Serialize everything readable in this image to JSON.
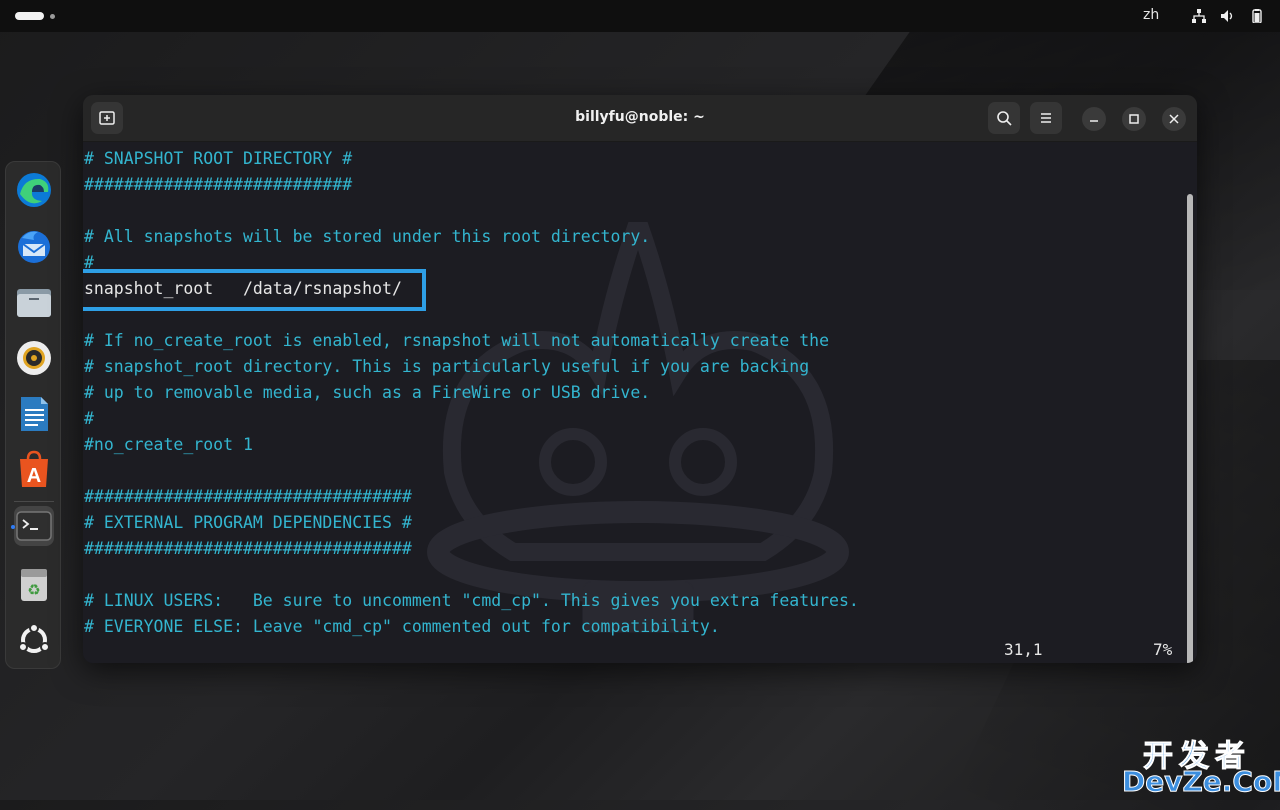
{
  "topbar": {
    "language": "zh",
    "tray_icons": [
      "network-icon",
      "volume-icon",
      "battery-icon"
    ]
  },
  "dock": {
    "apps": [
      {
        "name": "edge-icon"
      },
      {
        "name": "thunderbird-icon"
      },
      {
        "name": "files-icon"
      },
      {
        "name": "rhythmbox-icon"
      },
      {
        "name": "libreoffice-writer-icon"
      },
      {
        "name": "app-center-icon"
      },
      {
        "name": "terminal-icon",
        "active": true
      },
      {
        "name": "trash-icon"
      },
      {
        "name": "show-apps-icon"
      }
    ]
  },
  "window": {
    "title": "billyfu@noble: ~",
    "buttons": [
      "new-tab-icon",
      "search-icon",
      "menu-icon",
      "minimize-icon",
      "maximize-icon",
      "close-icon"
    ]
  },
  "editor": {
    "lines": [
      {
        "text": "# SNAPSHOT ROOT DIRECTORY #",
        "type": "comment"
      },
      {
        "text": "###########################",
        "type": "comment"
      },
      {
        "text": "",
        "type": "comment"
      },
      {
        "text": "# All snapshots will be stored under this root directory.",
        "type": "comment"
      },
      {
        "text": "#",
        "type": "comment"
      },
      {
        "text": "snapshot_root   /data/rsnapshot/",
        "type": "plain"
      },
      {
        "text": "",
        "type": "comment"
      },
      {
        "text": "# If no_create_root is enabled, rsnapshot will not automatically create the",
        "type": "comment"
      },
      {
        "text": "# snapshot_root directory. This is particularly useful if you are backing",
        "type": "comment"
      },
      {
        "text": "# up to removable media, such as a FireWire or USB drive.",
        "type": "comment"
      },
      {
        "text": "#",
        "type": "comment"
      },
      {
        "text": "#no_create_root 1",
        "type": "comment"
      },
      {
        "text": "",
        "type": "comment"
      },
      {
        "text": "#################################",
        "type": "comment"
      },
      {
        "text": "# EXTERNAL PROGRAM DEPENDENCIES #",
        "type": "comment"
      },
      {
        "text": "#################################",
        "type": "comment"
      },
      {
        "text": "",
        "type": "comment"
      },
      {
        "text": "# LINUX USERS:   Be sure to uncomment \"cmd_cp\". This gives you extra features.",
        "type": "comment"
      },
      {
        "text": "# EVERYONE ELSE: Leave \"cmd_cp\" commented out for compatibility.",
        "type": "comment"
      }
    ],
    "status_position": "31,1",
    "status_percent": "7%"
  },
  "site_mark": {
    "cn": "开发者",
    "en": "DevZe.CoM"
  },
  "colors": {
    "comment": "#33b5cf",
    "text": "#e6e6e6",
    "highlight": "#2e9fe6"
  }
}
